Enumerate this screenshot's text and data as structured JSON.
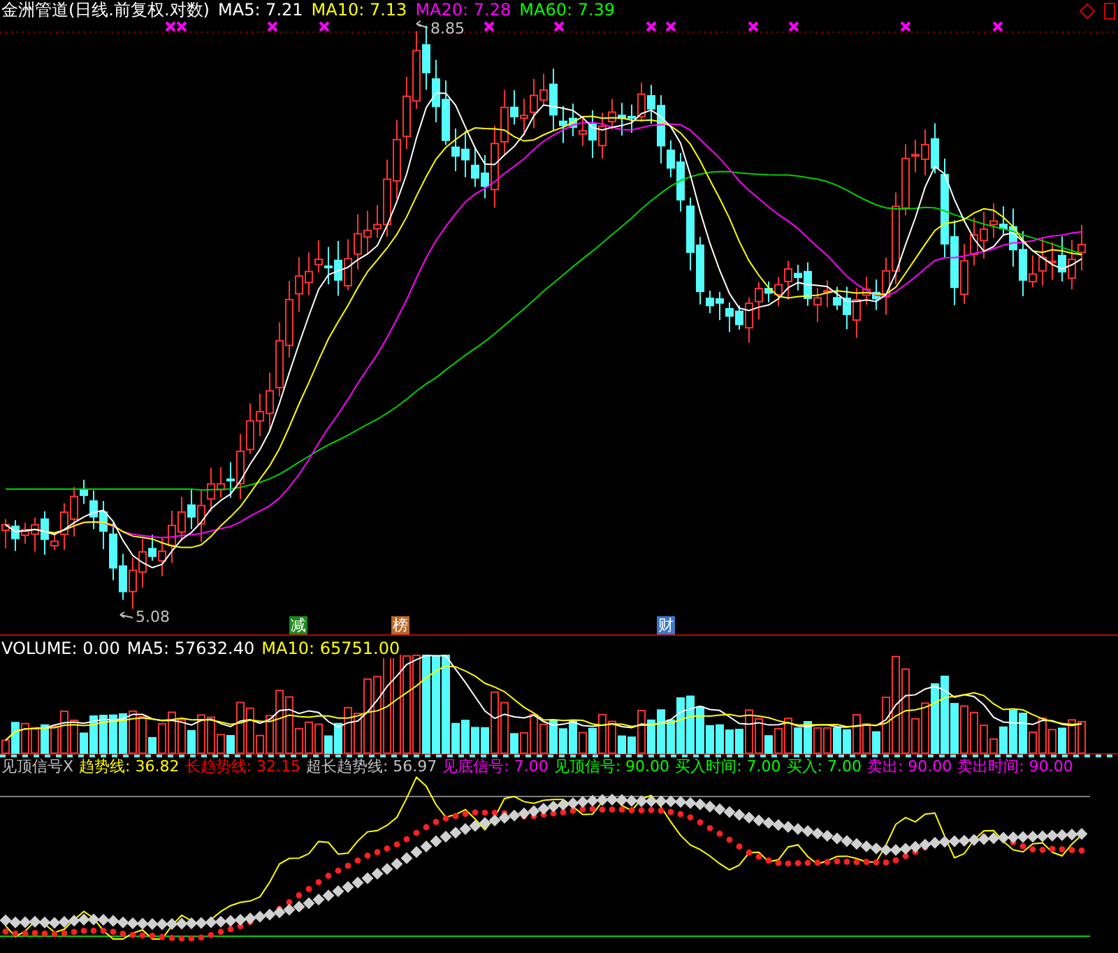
{
  "price_panel": {
    "title": "金洲管道(日线.前复权.对数)",
    "indicators": [
      {
        "label": "MA5: 7.21",
        "color": "#ffffff"
      },
      {
        "label": "MA10: 7.13",
        "color": "#ffff00"
      },
      {
        "label": "MA20: 7.28",
        "color": "#ff00ff"
      },
      {
        "label": "MA60: 7.39",
        "color": "#00ff00"
      }
    ],
    "high_label": "8.85",
    "low_label": "5.08",
    "event_tags": [
      {
        "text": "减",
        "color": "#1e8a1e"
      },
      {
        "text": "榜",
        "color": "#b8682a"
      },
      {
        "text": "财",
        "color": "#3c78c8"
      }
    ]
  },
  "volume_panel": {
    "indicators": [
      {
        "label": "VOLUME: 0.00",
        "color": "#ffffff"
      },
      {
        "label": "MA5: 57632.40",
        "color": "#ffffff"
      },
      {
        "label": "MA10: 65751.00",
        "color": "#ffff00"
      }
    ]
  },
  "signal_panel": {
    "indicators": [
      {
        "label": "见顶信号X",
        "color": "#c0c0c0"
      },
      {
        "label": "趋势线: 36.82",
        "color": "#ffff00"
      },
      {
        "label": "长趋势线: 32.15",
        "color": "#ff0000"
      },
      {
        "label": "超长趋势线: 56.97",
        "color": "#c0c0c0"
      },
      {
        "label": "见底信号: 7.00",
        "color": "#ff00ff"
      },
      {
        "label": "见顶信号: 90.00",
        "color": "#00ff00"
      },
      {
        "label": "买入时间: 7.00",
        "color": "#00ff00"
      },
      {
        "label": "买入: 7.00",
        "color": "#00ff00"
      },
      {
        "label": "卖出: 90.00",
        "color": "#ff00ff"
      },
      {
        "label": "卖出时间: 90.00",
        "color": "#ff00ff"
      }
    ]
  }
}
